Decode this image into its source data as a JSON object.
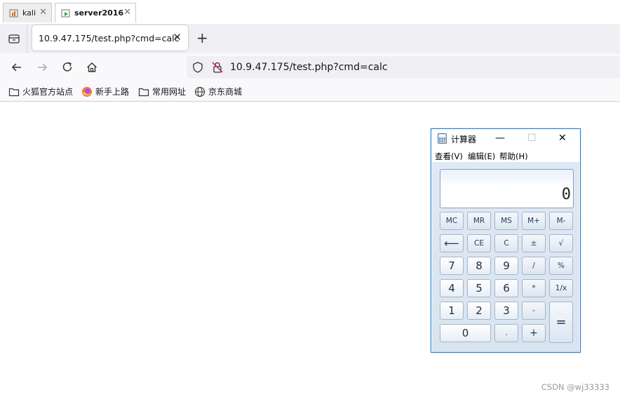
{
  "vm_tabs": [
    {
      "label": "kali",
      "active": false,
      "close": "✕"
    },
    {
      "label": "server2016",
      "active": true,
      "close": "✕"
    }
  ],
  "browser": {
    "tab_title": "10.9.47.175/test.php?cmd=calc",
    "tab_close": "✕",
    "new_tab": "+",
    "url": "10.9.47.175/test.php?cmd=calc",
    "bookmarks": [
      {
        "label": "火狐官方站点",
        "icon": "folder-icon"
      },
      {
        "label": "新手上路",
        "icon": "firefox-icon"
      },
      {
        "label": "常用网址",
        "icon": "folder-icon"
      },
      {
        "label": "京东商城",
        "icon": "globe-icon"
      }
    ]
  },
  "calculator": {
    "title": "计算器",
    "minimize": "—",
    "maximize": "☐",
    "close": "✕",
    "menu": [
      "查看(V)",
      "编辑(E)",
      "帮助(H)"
    ],
    "display": "0",
    "keys": {
      "mc": "MC",
      "mr": "MR",
      "ms": "MS",
      "mplus": "M+",
      "mminus": "M-",
      "back": "⟵",
      "ce": "CE",
      "c": "C",
      "plusminus": "±",
      "sqrt": "√",
      "seven": "7",
      "eight": "8",
      "nine": "9",
      "divide": "/",
      "percent": "%",
      "four": "4",
      "five": "5",
      "six": "6",
      "multiply": "*",
      "reciprocal": "1/x",
      "one": "1",
      "two": "2",
      "three": "3",
      "minus": "-",
      "equals": "=",
      "zero": "0",
      "dot": ".",
      "plus": "+"
    }
  },
  "watermark": "CSDN @wj33333",
  "colors": {
    "accent": "#1a7bd3",
    "firefox_orange": "#ff7139",
    "urlbar_bg": "#f0f0f4"
  }
}
